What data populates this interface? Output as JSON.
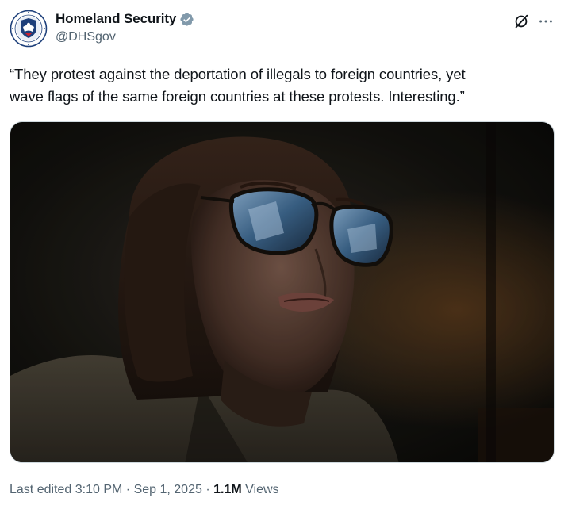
{
  "author": {
    "display_name": "Homeland Security",
    "handle": "@DHSgov",
    "verified_badge": "gray-verified-badge",
    "avatar": "dhs-seal"
  },
  "header_actions": {
    "grok_icon": "grok-icon",
    "more_icon": "more-icon"
  },
  "tweet": {
    "text": "“They protest against the deportation of illegals to foreign countries, yet\nwave flags of the same foreign countries at these protests. Interesting.”"
  },
  "media": {
    "description_icon": "image"
  },
  "footer": {
    "edited_label": "Last edited",
    "time": "3:10 PM",
    "separator": "·",
    "date": "Sep 1, 2025",
    "views_count": "1.1M",
    "views_label": "Views"
  },
  "colors": {
    "text_primary": "#0f1419",
    "text_secondary": "#536471",
    "verified_gray": "#829aab",
    "seal_blue": "#1d3f7a"
  }
}
